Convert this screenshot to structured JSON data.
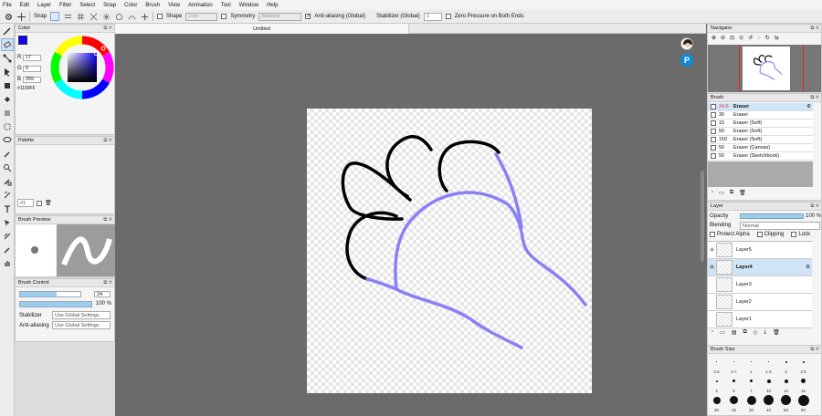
{
  "menu": [
    "File",
    "Edit",
    "Layer",
    "Filter",
    "Select",
    "Snap",
    "Color",
    "Brush",
    "View",
    "Animation",
    "Tool",
    "Window",
    "Help"
  ],
  "toolbar": {
    "snap_label": "Snap",
    "shape_label": "Shape",
    "shape_value": "Line",
    "symmetry_label": "Symmetry",
    "symmetry_value": "Bilateral",
    "antialias_label": "Anti-aliasing (Global)",
    "stabilizer_label": "Stabilizer (Global)",
    "stabilizer_value": "1",
    "zero_pressure_label": "Zero Pressure on Both Ends"
  },
  "document": {
    "tab_title": "Untitled"
  },
  "color_panel": {
    "title": "Color",
    "r_label": "R",
    "r_value": "17",
    "g_label": "G",
    "g_value": "0",
    "b_label": "B",
    "b_value": "255",
    "hex": "#1100FF",
    "primary_color": "#1100ff",
    "secondary_color": "#ffffff"
  },
  "palette_panel": {
    "title": "Palette",
    "page": "#1"
  },
  "brush_preview_panel": {
    "title": "Brush Preview"
  },
  "brush_control_panel": {
    "title": "Brush Control",
    "size_value": "24",
    "size_fill": 0.6,
    "opacity_value": "100 %",
    "opacity_fill": 1.0,
    "stabilizer_label": "Stabilizer",
    "stabilizer_value": "Use Global Settings",
    "antialias_label": "Anti-aliasing",
    "antialias_value": "Use Global Settings"
  },
  "navigator_panel": {
    "title": "Navigator"
  },
  "brush_panel": {
    "title": "Brush",
    "items": [
      {
        "size": "24.6",
        "name": "Eraser",
        "selected": true
      },
      {
        "size": "30",
        "name": "Eraser"
      },
      {
        "size": "15",
        "name": "Eraser (Soft)"
      },
      {
        "size": "50",
        "name": "Eraser (Soft)"
      },
      {
        "size": "150",
        "name": "Eraser (Soft)"
      },
      {
        "size": "50",
        "name": "Eraser (Canvas)"
      },
      {
        "size": "50",
        "name": "Eraser (Sketchbook)"
      }
    ]
  },
  "layer_panel": {
    "title": "Layer",
    "opacity_label": "Opacity",
    "opacity_value": "100 %",
    "blending_label": "Blending",
    "blending_value": "Normal",
    "protect_alpha_label": "Protect Alpha",
    "clipping_label": "Clipping",
    "lock_label": "Lock",
    "layers": [
      {
        "name": "Layer5"
      },
      {
        "name": "Layer4",
        "selected": true
      },
      {
        "name": "Layer3"
      },
      {
        "name": "Layer2"
      },
      {
        "name": "Layer1"
      }
    ]
  },
  "brush_size_panel": {
    "title": "Brush Size",
    "sizes": [
      [
        "0.5",
        "0.7",
        "1",
        "1.5",
        "2",
        "2.5"
      ],
      [
        "4",
        "5",
        "7",
        "10",
        "12",
        "15"
      ],
      [
        "20",
        "25",
        "30",
        "40",
        "50",
        "60"
      ]
    ]
  },
  "colors": {
    "stroke_black": "#000000",
    "stroke_blue": "#8a80f5",
    "accent": "#9bcdee"
  }
}
